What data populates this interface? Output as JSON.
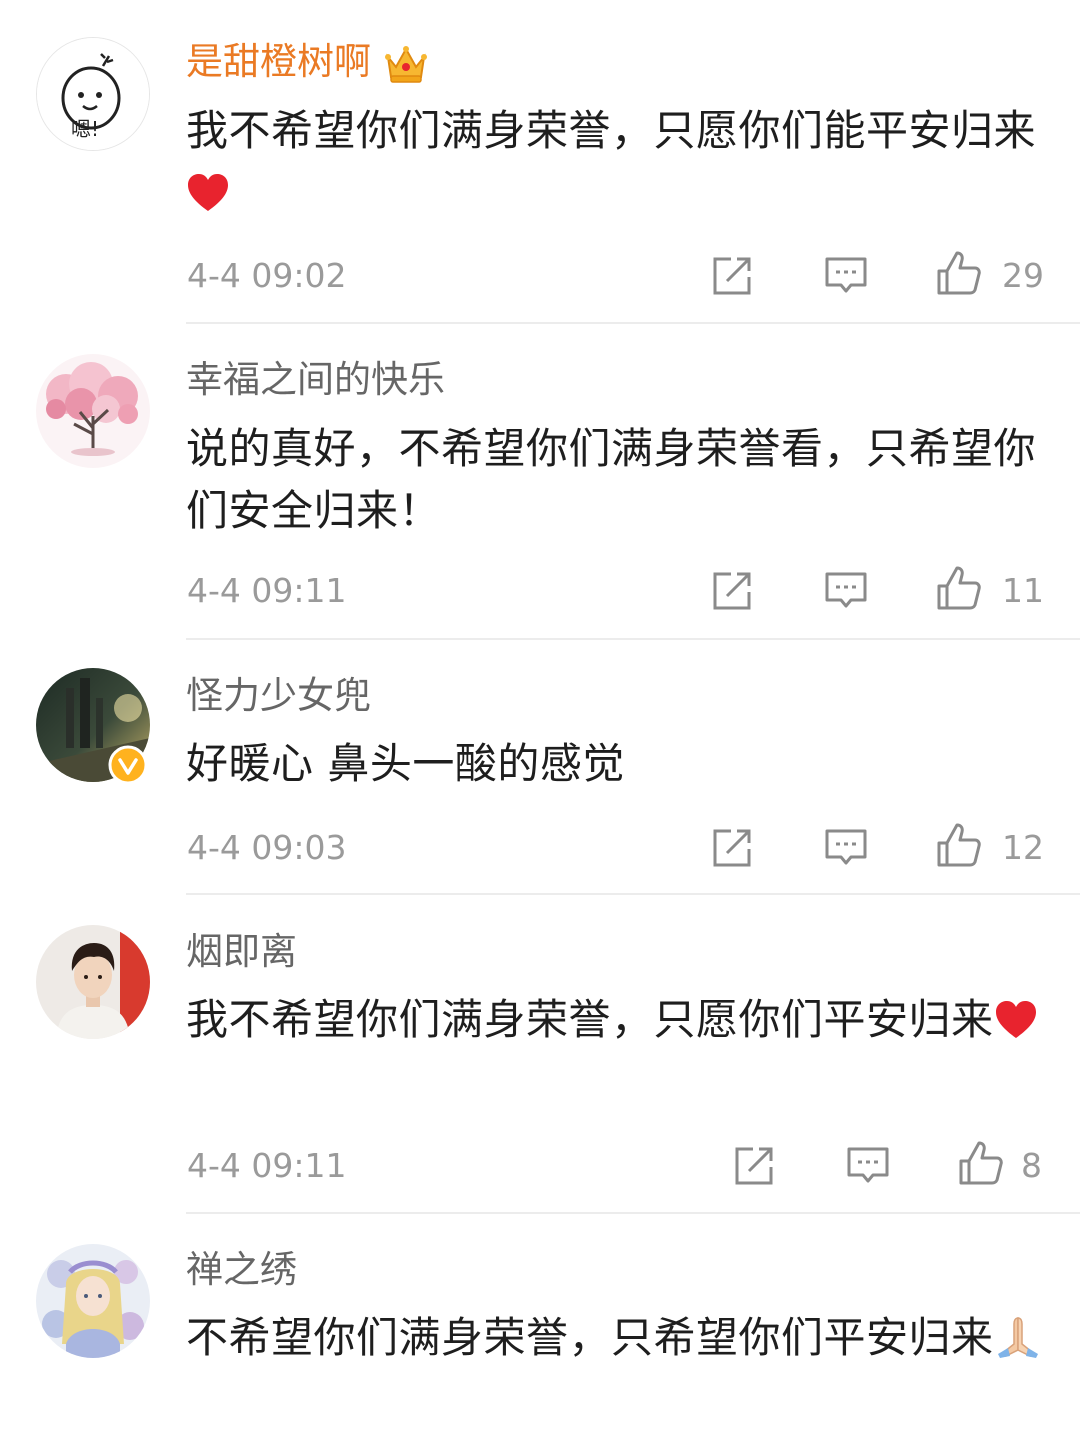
{
  "colors": {
    "vip_name": "#ea7a24",
    "name": "#666666",
    "text": "#1e1e1e",
    "meta": "#9a9a9a",
    "heart": "#e8232e",
    "divider": "#ececec"
  },
  "comments": [
    {
      "username": "是甜橙树啊",
      "vip": true,
      "badge_icon": "crown-icon",
      "text": "我不希望你们满身荣誉，只愿你们能平安归来",
      "emoji": "heart-emoji",
      "time": "4-4 09:02",
      "likes": "29"
    },
    {
      "username": "幸福之间的快乐",
      "text": "说的真好，不希望你们满身荣誉看，只希望你们安全归来！",
      "time": "4-4 09:11",
      "likes": "11"
    },
    {
      "username": "怪力少女兜",
      "verified": true,
      "text": "好暖心 鼻头一酸的感觉",
      "time": "4-4 09:03",
      "likes": "12"
    },
    {
      "username": "烟即离",
      "text": "我不希望你们满身荣誉，只愿你们平安归来",
      "emoji": "heart-emoji",
      "time": "4-4 09:11",
      "likes": "8"
    },
    {
      "username": "禅之绣",
      "text": "不希望你们满身荣誉，只希望你们平安归来",
      "emoji": "praying-hands-emoji",
      "time": "",
      "likes": ""
    }
  ],
  "icons": {
    "share": "share-icon",
    "reply": "comment-icon",
    "like": "thumbs-up-icon"
  }
}
